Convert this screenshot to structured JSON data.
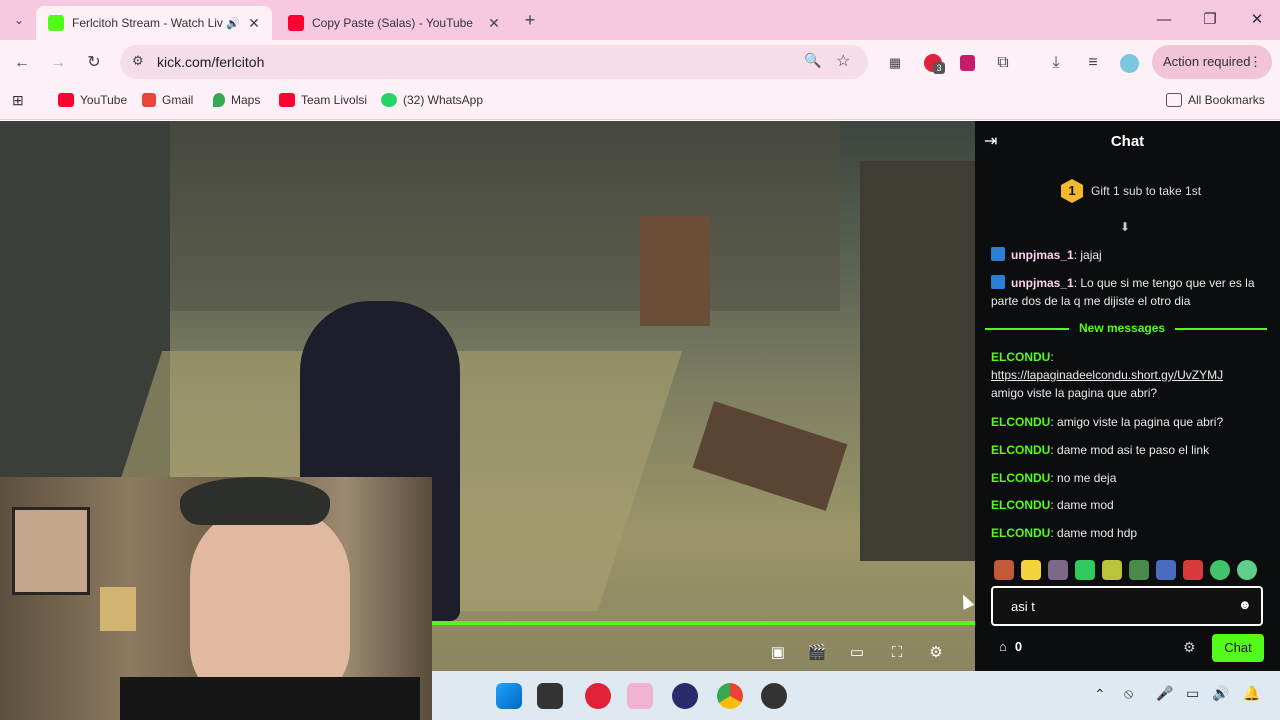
{
  "browser": {
    "tabs": [
      {
        "title": "Ferlcitoh Stream - Watch Liv",
        "active": true
      },
      {
        "title": "Copy Paste (Salas) - YouTube",
        "active": false
      }
    ],
    "url": "kick.com/ferlcitoh",
    "extension_badge": "3",
    "action_required": "Action required"
  },
  "bookmarks": [
    "YouTube",
    "Gmail",
    "Maps",
    "Team Livolsi",
    "(32) WhatsApp"
  ],
  "all_bookmarks": "All Bookmarks",
  "chat": {
    "title": "Chat",
    "gift_rank": "1",
    "gift_text": "Gift 1 sub to take 1st",
    "new_messages": "New messages",
    "messages": [
      {
        "user": "unpjmas_1",
        "text": "jajaj"
      },
      {
        "user": "unpjmas_1",
        "text": "Lo que si me tengo que ver es la parte dos de la q me dijiste el otro dia"
      },
      {
        "user": "ELCONDU",
        "link": "https://lapaginadeelcondu.short.gy/UvZYMJ",
        "text": "amigo viste la pagina que abri?"
      },
      {
        "user": "ELCONDU",
        "text": "amigo viste la pagina que abri?"
      },
      {
        "user": "ELCONDU",
        "text": "dame mod asi te paso el link"
      },
      {
        "user": "ELCONDU",
        "text": "no me deja"
      },
      {
        "user": "ELCONDU",
        "text": "dame mod"
      },
      {
        "user": "ELCONDU",
        "text": "dame mod hdp"
      }
    ],
    "input_value": "asi t",
    "points": "0",
    "send_label": "Chat"
  },
  "colors": {
    "kick_green": "#53fc18",
    "tab_bar": "#f6c9e0",
    "chat_bg": "#0b0d0e"
  }
}
